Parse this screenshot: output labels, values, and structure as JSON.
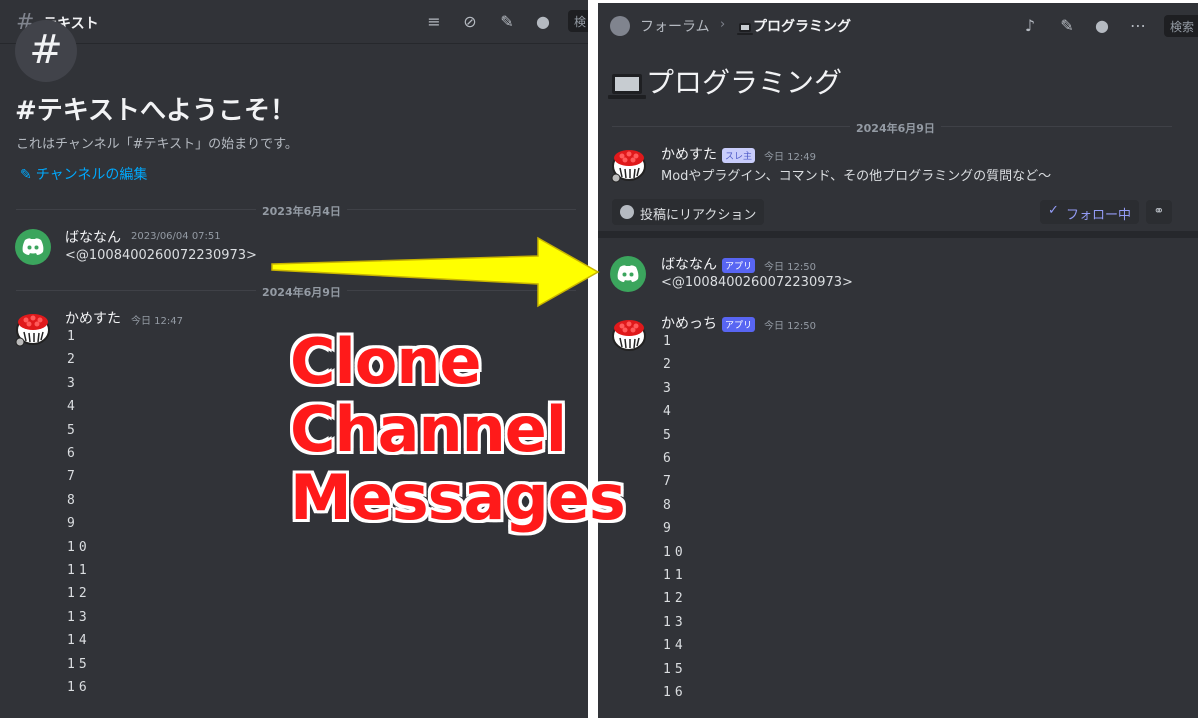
{
  "left": {
    "header": {
      "channel_name": "テキスト",
      "search_label": "検"
    },
    "welcome_title": "#テキストへようこそ！",
    "start_text": "これはチャンネル「#テキスト」の始まりです。",
    "edit_channel": "チャンネルの編集",
    "date1": "2023年6月4日",
    "msg1": {
      "user": "ばななん",
      "time": "2023/06/04 07:51",
      "text": "<@1008400260072230973>"
    },
    "date2": "2024年6月9日",
    "msg2": {
      "user": "かめすた",
      "time": "今日 12:47",
      "lines": [
        "1",
        "2",
        "3",
        "4",
        "5",
        "6",
        "7",
        "8",
        "9",
        "10",
        "11",
        "12",
        "13",
        "14",
        "15",
        "16"
      ]
    }
  },
  "overlay": {
    "line1": "Clone",
    "line2": "Channel",
    "line3": "Messages"
  },
  "right": {
    "header": {
      "forum_label": "フォーラム",
      "thread_title": "プログラミング",
      "search_label": "検索"
    },
    "title": "プログラミング",
    "date": "2024年6月9日",
    "op": {
      "user": "かめすた",
      "badge": "スレ主",
      "time": "今日 12:49",
      "text": "Modやプラグイン、コマンド、その他プログラミングの質問など～"
    },
    "react_label": "投稿にリアクション",
    "follow_label": "フォロー中",
    "msg1": {
      "user": "ばななん",
      "badge": "アプリ",
      "time": "今日 12:50",
      "text": "<@1008400260072230973>"
    },
    "msg2": {
      "user": "かめっち",
      "badge": "アプリ",
      "time": "今日 12:50",
      "lines": [
        "1",
        "2",
        "3",
        "4",
        "5",
        "6",
        "7",
        "8",
        "9",
        "10",
        "11",
        "12",
        "13",
        "14",
        "15",
        "16"
      ]
    }
  },
  "colors": {
    "bg": "#313338",
    "accent": "#5865f2",
    "link": "#00a8fc",
    "overlay_text": "#ff1a1a",
    "arrow": "#ffff00"
  }
}
